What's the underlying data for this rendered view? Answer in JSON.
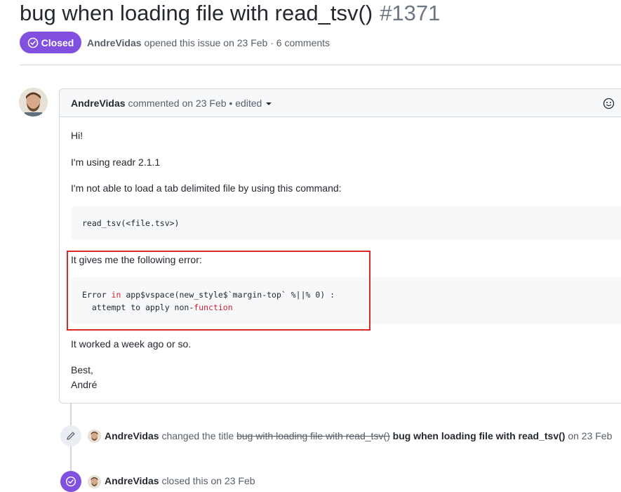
{
  "issue": {
    "title": "bug when loading file with read_tsv()",
    "number": "#1371",
    "state": "Closed",
    "author": "AndreVidas",
    "meta_rest": "opened this issue on 23 Feb · 6 comments"
  },
  "comment": {
    "author": "AndreVidas",
    "header_rest": "commented on 23 Feb • edited",
    "body": {
      "p1": "Hi!",
      "p2": "I'm using readr 2.1.1",
      "p3": "I'm not able to load a tab delimited file by using this command:",
      "code1": "read_tsv(<file.tsv>)",
      "p4": "It gives me the following error:",
      "code2_line1_a": "Error ",
      "code2_line1_in": "in",
      "code2_line1_b": " app$vspace(new_style$`margin-top` %||% 0) :",
      "code2_line2_a": "  attempt to apply non-",
      "code2_line2_fn": "function",
      "p5": "It worked a week ago or so.",
      "p6": "Best,",
      "p7": "André"
    }
  },
  "timeline": [
    {
      "icon": "pencil-icon",
      "author": "AndreVidas",
      "text_a": "changed the title",
      "old_title": "bug with loading file with read_tsv()",
      "new_title": "bug when loading file with read_tsv()",
      "text_b": "on 23 Feb"
    },
    {
      "icon": "check-circle-icon",
      "author": "AndreVidas",
      "text": "closed this on 23 Feb"
    }
  ],
  "colors": {
    "closed_purple": "#8250df",
    "highlight_red": "#d42a2a"
  }
}
